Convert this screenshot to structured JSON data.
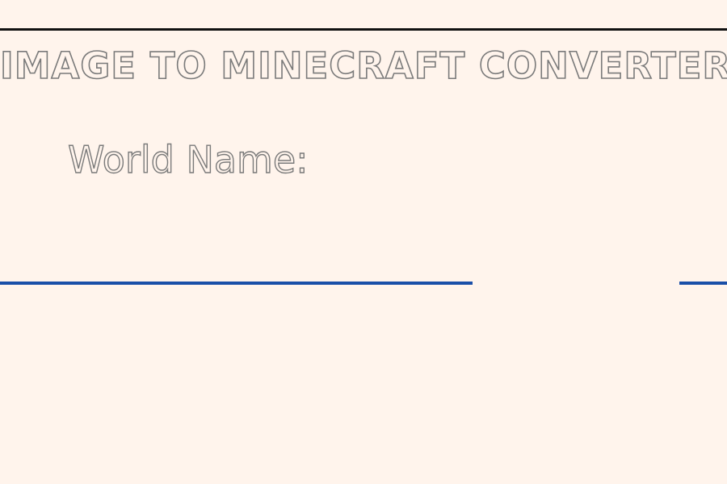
{
  "header": {
    "title": "IMAGE TO MINECRAFT CONVERTER"
  },
  "form": {
    "world_name": {
      "label": "World Name:",
      "value": "",
      "placeholder": ""
    }
  },
  "colors": {
    "background": "#fff4ec",
    "top_rule": "#111111",
    "text_outline": "#7a7a7a",
    "input_underline": "#1a4fa8"
  }
}
